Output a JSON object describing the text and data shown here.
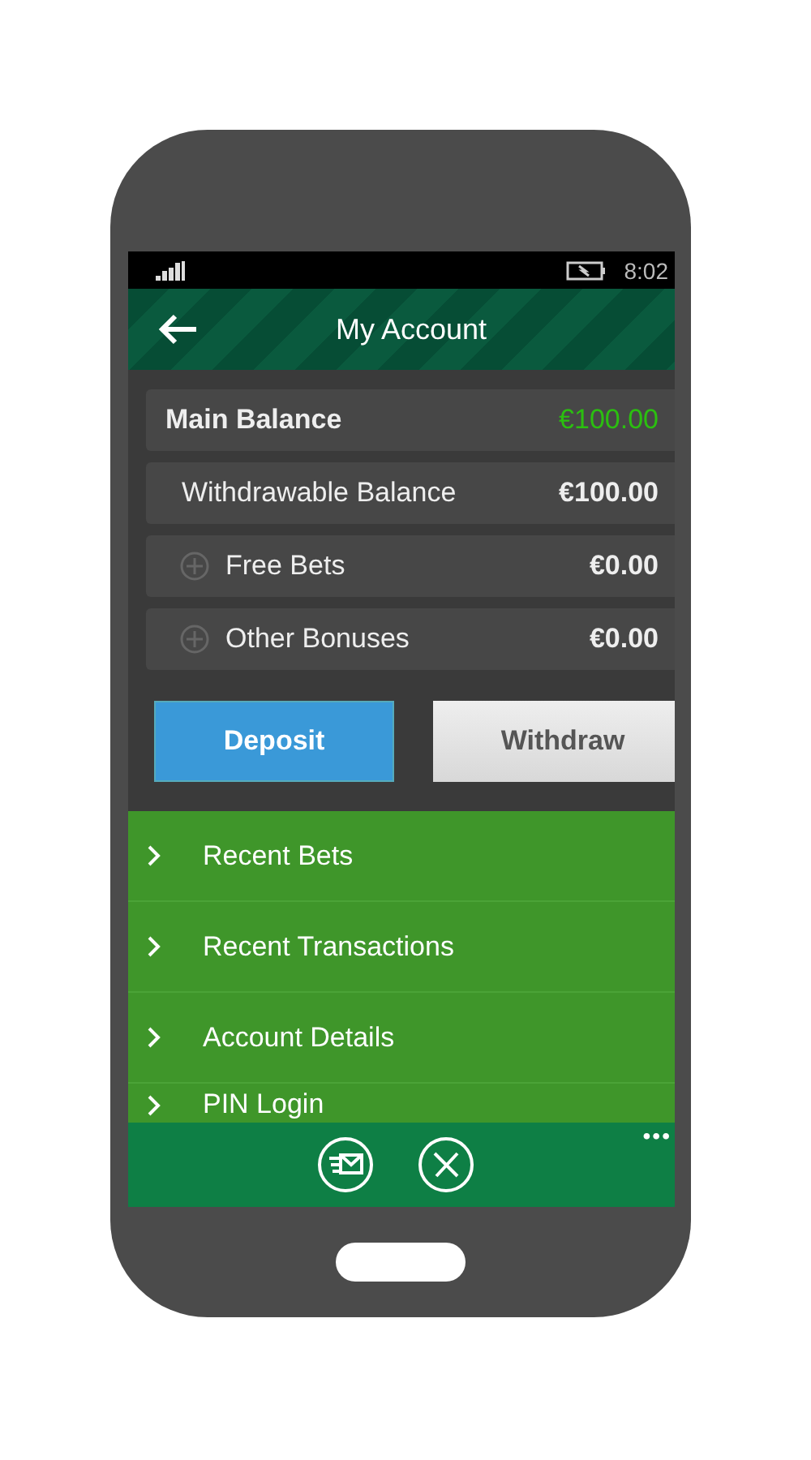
{
  "status_bar": {
    "time": "8:02"
  },
  "header": {
    "title": "My Account"
  },
  "balances": [
    {
      "kind": "main",
      "label": "Main Balance",
      "amount": "€100.00"
    },
    {
      "kind": "plain",
      "label": "Withdrawable Balance",
      "amount": "€100.00"
    },
    {
      "kind": "expandable",
      "label": "Free Bets",
      "amount": "€0.00"
    },
    {
      "kind": "expandable",
      "label": "Other Bonuses",
      "amount": "€0.00"
    }
  ],
  "buttons": [
    {
      "kind": "primary",
      "label": "Deposit"
    },
    {
      "kind": "secondary",
      "label": "Withdraw"
    }
  ],
  "menu": [
    {
      "label": "Recent Bets"
    },
    {
      "label": "Recent Transactions"
    },
    {
      "label": "Account Details"
    },
    {
      "label": "PIN Login"
    }
  ],
  "app_bar": {
    "more": "•••"
  }
}
